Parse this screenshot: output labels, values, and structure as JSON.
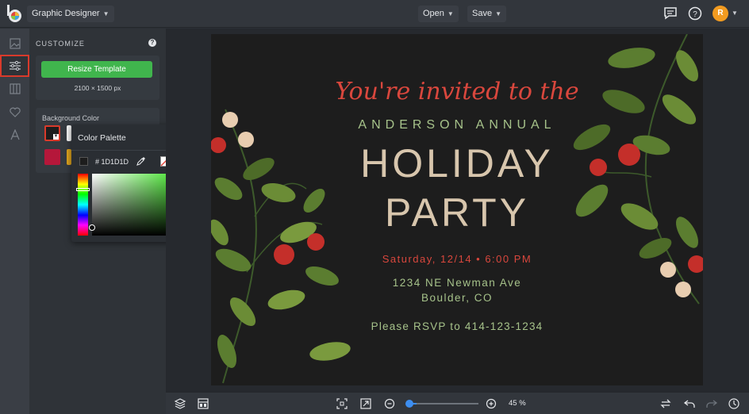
{
  "topbar": {
    "mode_label": "Graphic Designer",
    "open_label": "Open",
    "save_label": "Save",
    "avatar_initial": "R"
  },
  "panel": {
    "title": "CUSTOMIZE",
    "resize_label": "Resize Template",
    "dimensions": "2100 × 1500 px",
    "bg_color_label": "Background Color"
  },
  "color_popover": {
    "title": "Color Palette",
    "hex": "# 1D1D1D"
  },
  "invitation": {
    "line1": "You're invited to the",
    "line2": "ANDERSON ANNUAL",
    "line3": "HOLIDAY",
    "line4": "PARTY",
    "date": "Saturday, 12/14 • 6:00 PM",
    "address1": "1234 NE Newman Ave",
    "address2": "Boulder, CO",
    "rsvp": "Please RSVP to 414-123-1234"
  },
  "zoom": {
    "label": "45 %",
    "value_percent": 45
  },
  "colors": {
    "accent_green": "#40b54d",
    "accent_red": "#d93a2b",
    "canvas_bg": "#1d1d1d",
    "avatar": "#f29b20",
    "swatch_crimson": "#b5173a",
    "swatch_gold": "#d9a01e"
  }
}
